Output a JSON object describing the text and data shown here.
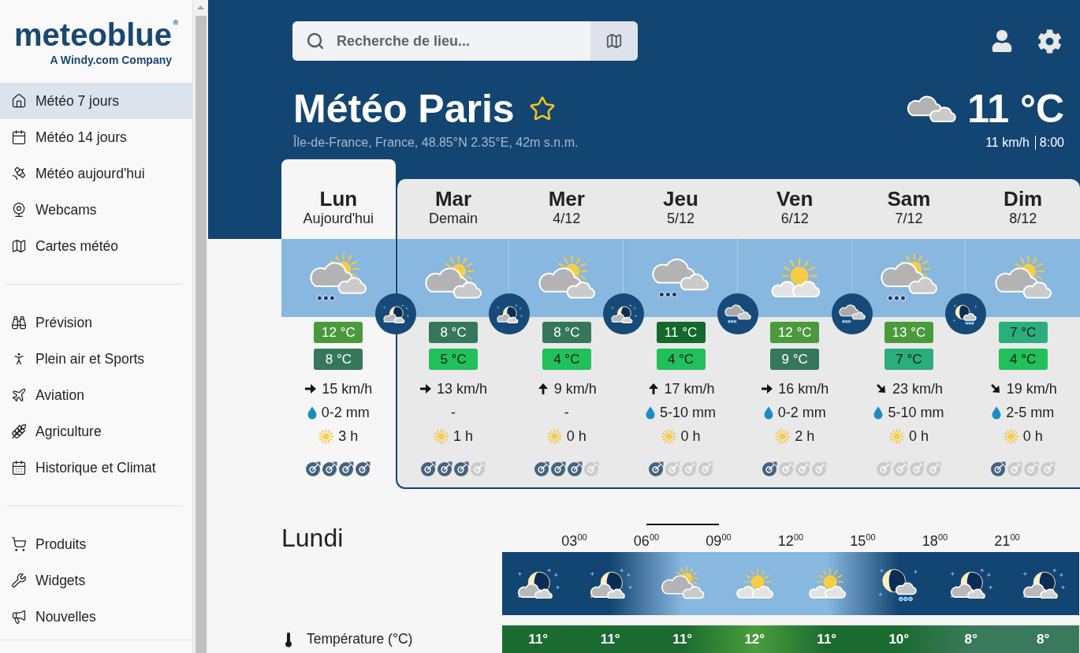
{
  "sidebar": {
    "logo": {
      "wordmark": "meteoblue",
      "mark": "®",
      "tagline": "A Windy.com Company"
    },
    "sections": [
      {
        "items": [
          {
            "label": "Météo 7 jours",
            "selected": true
          },
          {
            "label": "Météo 14 jours",
            "selected": false
          },
          {
            "label": "Météo aujourd'hui",
            "selected": false
          },
          {
            "label": "Webcams",
            "selected": false
          },
          {
            "label": "Cartes météo",
            "selected": false
          }
        ]
      },
      {
        "items": [
          {
            "label": "Prévision",
            "selected": false
          },
          {
            "label": "Plein air et Sports",
            "selected": false
          },
          {
            "label": "Aviation",
            "selected": false
          },
          {
            "label": "Agriculture",
            "selected": false
          },
          {
            "label": "Historique et Climat",
            "selected": false
          }
        ]
      },
      {
        "items": [
          {
            "label": "Produits",
            "selected": false
          },
          {
            "label": "Widgets",
            "selected": false
          },
          {
            "label": "Nouvelles",
            "selected": false
          }
        ]
      }
    ]
  },
  "search": {
    "placeholder": "Recherche de lieu..."
  },
  "location": {
    "title": "Météo Paris",
    "favorite": false,
    "subtitle": "Île-de-France, France, 48.85°N 2.35°E, 42m s.n.m."
  },
  "current": {
    "sky": {
      "kind": "overcast"
    },
    "temperature": "11 °C",
    "wind": "11 km/h",
    "time": "8:00"
  },
  "days": [
    {
      "name": "Lun",
      "subtitle": "Aujourd'hui",
      "selected": true,
      "sky": {
        "kind": "showers"
      },
      "night": {
        "kind": "moon"
      },
      "max": {
        "text": "12 °C",
        "color": "#4a9a3c"
      },
      "min": {
        "text": "8 °C",
        "color": "#35775a"
      },
      "wind": {
        "arrow": {
          "kind": "right"
        },
        "text": "15 km/h"
      },
      "precipitation": {
        "text": "0-2 mm",
        "drop": true
      },
      "sunshine": "3 h",
      "predictability": [
        {
          "filled": true
        },
        {
          "filled": true
        },
        {
          "filled": true
        },
        {
          "filled": true
        }
      ]
    },
    {
      "name": "Mar",
      "subtitle": "Demain",
      "selected": false,
      "sky": {
        "kind": "cloudy"
      },
      "night": {
        "kind": "moon"
      },
      "max": {
        "text": "8 °C",
        "color": "#35775a"
      },
      "min": {
        "text": "5 °C",
        "color": "#22c05a"
      },
      "wind": {
        "arrow": {
          "kind": "right"
        },
        "text": "13 km/h"
      },
      "precipitation": {
        "text": "-",
        "drop": false
      },
      "sunshine": "1 h",
      "predictability": [
        {
          "filled": true
        },
        {
          "filled": true
        },
        {
          "filled": true
        },
        {
          "filled": false
        }
      ]
    },
    {
      "name": "Mer",
      "subtitle": "4/12",
      "selected": false,
      "sky": {
        "kind": "cloudy"
      },
      "night": {
        "kind": "moon"
      },
      "max": {
        "text": "8 °C",
        "color": "#35775a"
      },
      "min": {
        "text": "4 °C",
        "color": "#22c05a"
      },
      "wind": {
        "arrow": {
          "kind": "up"
        },
        "text": "9 km/h"
      },
      "precipitation": {
        "text": "-",
        "drop": false
      },
      "sunshine": "0 h",
      "predictability": [
        {
          "filled": true
        },
        {
          "filled": true
        },
        {
          "filled": true
        },
        {
          "filled": false
        }
      ]
    },
    {
      "name": "Jeu",
      "subtitle": "5/12",
      "selected": false,
      "sky": {
        "kind": "rain"
      },
      "night": {
        "kind": "rain"
      },
      "max": {
        "text": "11 °C",
        "color": "#13692d"
      },
      "min": {
        "text": "4 °C",
        "color": "#22c05a"
      },
      "wind": {
        "arrow": {
          "kind": "up"
        },
        "text": "17 km/h"
      },
      "precipitation": {
        "text": "5-10 mm",
        "drop": true
      },
      "sunshine": "0 h",
      "predictability": [
        {
          "filled": true
        },
        {
          "filled": false
        },
        {
          "filled": false
        },
        {
          "filled": false
        }
      ]
    },
    {
      "name": "Ven",
      "subtitle": "6/12",
      "selected": false,
      "sky": {
        "kind": "sunny"
      },
      "night": {
        "kind": "rain"
      },
      "max": {
        "text": "12 °C",
        "color": "#4a9a3c"
      },
      "min": {
        "text": "9 °C",
        "color": "#35775a"
      },
      "wind": {
        "arrow": {
          "kind": "right"
        },
        "text": "16 km/h"
      },
      "precipitation": {
        "text": "0-2 mm",
        "drop": true
      },
      "sunshine": "2 h",
      "predictability": [
        {
          "filled": true
        },
        {
          "filled": false
        },
        {
          "filled": false
        },
        {
          "filled": false
        }
      ]
    },
    {
      "name": "Sam",
      "subtitle": "7/12",
      "selected": false,
      "sky": {
        "kind": "showers"
      },
      "night": {
        "kind": "moonrain"
      },
      "max": {
        "text": "13 °C",
        "color": "#4a9a3c"
      },
      "min": {
        "text": "7 °C",
        "color": "#2aae7c"
      },
      "wind": {
        "arrow": {
          "kind": "downright"
        },
        "text": "23 km/h"
      },
      "precipitation": {
        "text": "5-10 mm",
        "drop": true
      },
      "sunshine": "0 h",
      "predictability": [
        {
          "filled": false
        },
        {
          "filled": false
        },
        {
          "filled": false
        },
        {
          "filled": false
        }
      ]
    },
    {
      "name": "Dim",
      "subtitle": "8/12",
      "selected": false,
      "sky": {
        "kind": "cloudy"
      },
      "max": {
        "text": "7 °C",
        "color": "#2aae7c"
      },
      "min": {
        "text": "4 °C",
        "color": "#22c05a"
      },
      "wind": {
        "arrow": {
          "kind": "downright"
        },
        "text": "19 km/h"
      },
      "precipitation": {
        "text": "2-5 mm",
        "drop": true
      },
      "sunshine": "0 h",
      "predictability": [
        {
          "filled": true
        },
        {
          "filled": false
        },
        {
          "filled": false
        },
        {
          "filled": false
        }
      ]
    }
  ],
  "hourly": {
    "title": "Lundi",
    "times": [
      "03$^{00}$",
      "06$^{00}$",
      "09$^{00}$",
      "12$^{00}$",
      "15$^{00}$",
      "18$^{00}$",
      "21$^{00}$"
    ],
    "columns": [
      {
        "sky": {
          "kind": "moon"
        },
        "daylight": false,
        "current": false
      },
      {
        "sky": {
          "kind": "moon"
        },
        "daylight": false,
        "current": false
      },
      {
        "sky": {
          "kind": "cloudy"
        },
        "daylight": true,
        "current": true
      },
      {
        "sky": {
          "kind": "sunny"
        },
        "daylight": true,
        "current": false
      },
      {
        "sky": {
          "kind": "sunny"
        },
        "daylight": true,
        "current": false
      },
      {
        "sky": {
          "kind": "moonrain"
        },
        "daylight": false,
        "current": false
      },
      {
        "sky": {
          "kind": "moon"
        },
        "daylight": false,
        "current": false
      },
      {
        "sky": {
          "kind": "moon"
        },
        "daylight": false,
        "current": false
      }
    ],
    "rows": [
      {
        "label": "Température (°C)",
        "cells": [
          {
            "text": "11°",
            "color": "#1b6b30"
          },
          {
            "text": "11°",
            "color": "#1b6b30"
          },
          {
            "text": "11°",
            "color": "#1b6b30"
          },
          {
            "text": "12°",
            "color": "#4a9c3c"
          },
          {
            "text": "11°",
            "color": "#1b6b30"
          },
          {
            "text": "10°",
            "color": "#1b6b30"
          },
          {
            "text": "8°",
            "color": "#3a7a5c"
          },
          {
            "text": "8°",
            "color": "#3a7a5c"
          }
        ]
      }
    ]
  }
}
